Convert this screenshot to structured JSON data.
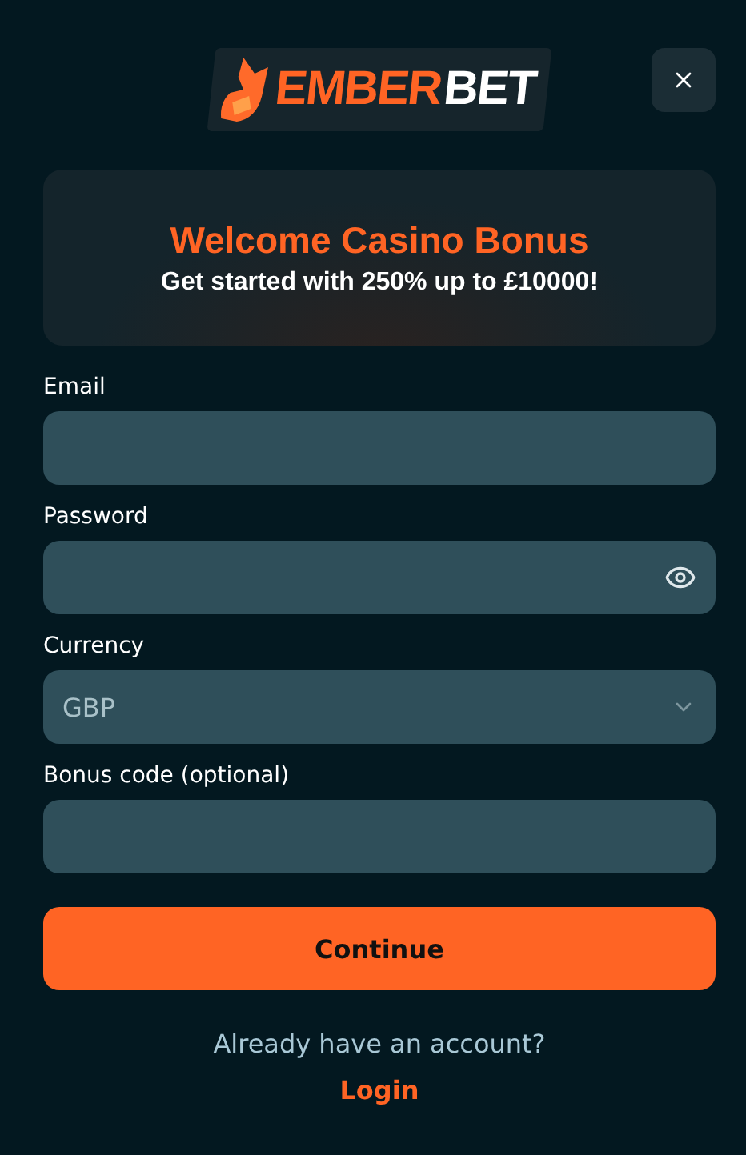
{
  "logo": {
    "part_1": "EMBER",
    "part_2": "BET"
  },
  "bonus": {
    "title": "Welcome Casino Bonus",
    "subtitle": "Get started with 250% up to £10000!"
  },
  "fields": [
    {
      "kind": "text",
      "label": "Email"
    },
    {
      "kind": "password",
      "label": "Password"
    },
    {
      "kind": "select",
      "label": "Currency",
      "value": "GBP"
    },
    {
      "kind": "text",
      "label": "Bonus code (optional)"
    }
  ],
  "submit": "Continue",
  "footer": {
    "prompt": "Already have an account?",
    "link": "Login"
  }
}
